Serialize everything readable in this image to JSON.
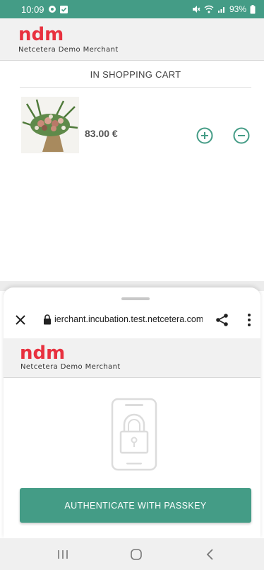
{
  "status_bar": {
    "time": "10:09",
    "battery": "93%",
    "icons": [
      "sync-icon",
      "check-box-icon",
      "mute-icon",
      "wifi-icon",
      "signal-icon",
      "battery-icon"
    ]
  },
  "merchant": {
    "logo": "ndm",
    "name": "Netcetera Demo Merchant",
    "logo_color": "#e8313f"
  },
  "cart": {
    "title": "IN SHOPPING CART",
    "items": [
      {
        "price": "83.00 €"
      }
    ]
  },
  "browser": {
    "url": "ierchant.incubation.test.netcetera.com"
  },
  "auth": {
    "button_label": "AUTHENTICATE WITH PASSKEY"
  },
  "colors": {
    "accent": "#449c86",
    "brand": "#e8313f"
  }
}
